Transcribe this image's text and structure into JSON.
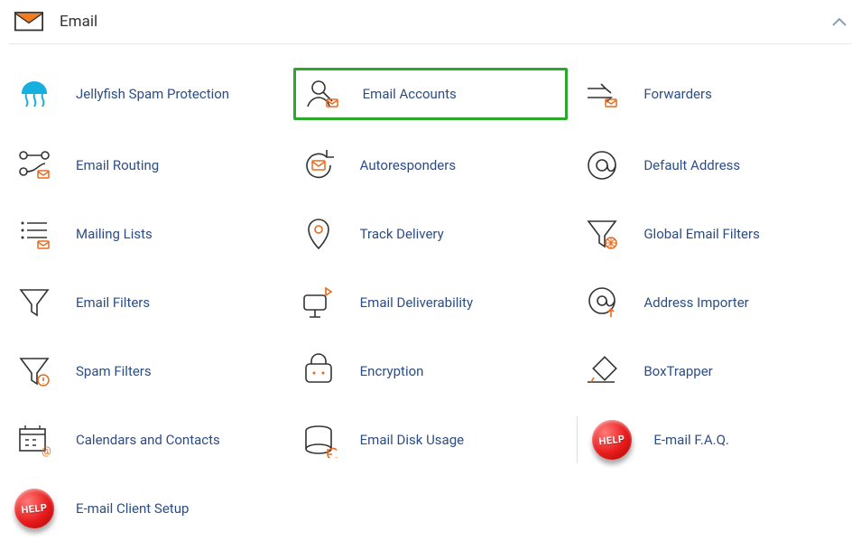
{
  "panel": {
    "title": "Email",
    "items": [
      {
        "id": "jellyfish",
        "label": "Jellyfish Spam Protection"
      },
      {
        "id": "email-accounts",
        "label": "Email Accounts",
        "highlighted": true
      },
      {
        "id": "forwarders",
        "label": "Forwarders"
      },
      {
        "id": "email-routing",
        "label": "Email Routing"
      },
      {
        "id": "autoresponders",
        "label": "Autoresponders"
      },
      {
        "id": "default-address",
        "label": "Default Address"
      },
      {
        "id": "mailing-lists",
        "label": "Mailing Lists"
      },
      {
        "id": "track-delivery",
        "label": "Track Delivery"
      },
      {
        "id": "global-filters",
        "label": "Global Email Filters"
      },
      {
        "id": "email-filters",
        "label": "Email Filters"
      },
      {
        "id": "email-deliverability",
        "label": "Email Deliverability"
      },
      {
        "id": "address-importer",
        "label": "Address Importer"
      },
      {
        "id": "spam-filters",
        "label": "Spam Filters"
      },
      {
        "id": "encryption",
        "label": "Encryption"
      },
      {
        "id": "boxtrapper",
        "label": "BoxTrapper"
      },
      {
        "id": "calendars",
        "label": "Calendars and Contacts"
      },
      {
        "id": "disk-usage",
        "label": "Email Disk Usage"
      },
      {
        "id": "faq",
        "label": "E-mail F.A.Q."
      },
      {
        "id": "client-setup",
        "label": "E-mail Client Setup"
      }
    ],
    "help_text": "HELP"
  }
}
